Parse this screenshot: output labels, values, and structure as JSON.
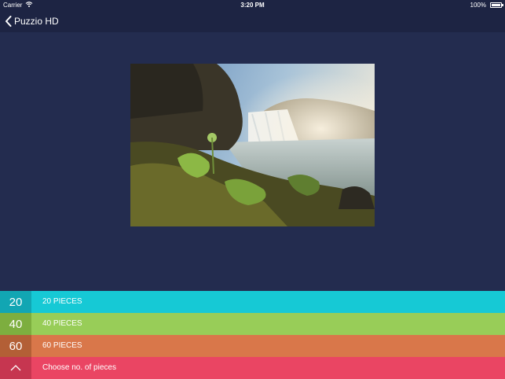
{
  "status_bar": {
    "carrier": "Carrier",
    "time": "3:20 PM",
    "battery": "100%"
  },
  "nav": {
    "back_label": "Puzzio HD"
  },
  "options": [
    {
      "number": "20",
      "label": "20 PIECES",
      "color": "#16c9d5",
      "accent": "#12a6b3"
    },
    {
      "number": "40",
      "label": "40 PIECES",
      "color": "#98cd58",
      "accent": "#7dae3f"
    },
    {
      "number": "60",
      "label": "60 PIECES",
      "color": "#d9774a",
      "accent": "#b35f36"
    }
  ],
  "chooser": {
    "label": "Choose no. of pieces",
    "icon": "chevron-up-icon",
    "color": "#ea4563"
  },
  "colors": {
    "background": "#232c4f",
    "bars": "#1d2443"
  }
}
